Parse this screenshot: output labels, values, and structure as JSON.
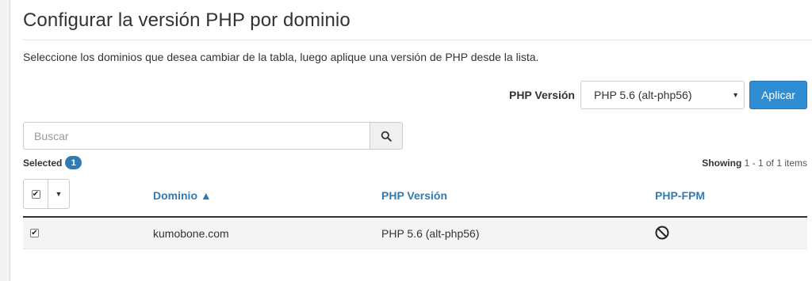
{
  "page": {
    "title": "Configurar la versión PHP por dominio",
    "instructions": "Seleccione los dominios que desea cambiar de la tabla, luego aplique una versión de PHP desde la lista."
  },
  "php_selector": {
    "label": "PHP Versión",
    "selected": "PHP 5.6 (alt-php56)",
    "apply_label": "Aplicar"
  },
  "search": {
    "placeholder": "Buscar"
  },
  "selection": {
    "label": "Selected",
    "count": "1"
  },
  "pagination": {
    "prefix": "Showing",
    "range": "1 - 1 of 1 items"
  },
  "table": {
    "columns": {
      "domain": "Dominio ▲",
      "php_version": "PHP Versión",
      "php_fpm": "PHP-FPM"
    },
    "rows": [
      {
        "checked": true,
        "domain": "kumobone.com",
        "php_version": "PHP 5.6 (alt-php56)",
        "php_fpm_icon": "prohibited-icon"
      }
    ]
  },
  "colors": {
    "accent": "#2f8ed3",
    "link": "#2f7bb5",
    "badge": "#2f7bb5"
  }
}
